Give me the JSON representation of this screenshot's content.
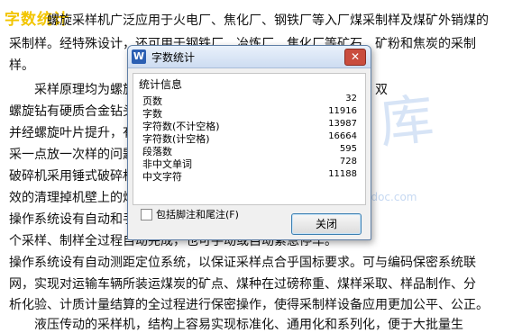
{
  "document": {
    "title": "字数统计",
    "lines": [
      "螺旋采样机广泛应用于火电厂、焦化厂、钢铁厂等入厂煤采制样及煤矿外销煤的",
      "采制样。经特殊设计，还可用于钢铁厂、冶炼厂、焦化厂等矿石、矿粉和焦炭的采制",
      "样。",
      "　　采样原理均为螺旋钻取方式，全断面采样，能避免样品污染。双",
      "螺旋钻有硬质合金钻头，对于大块煤或煤矸石钻碎，",
      "并经螺旋叶片提升，有效地解决了点采样须",
      "采一点放一次样的问题，实现采三点放一次样的目的。",
      "破碎机采用锤式破碎机，平移刮板，能及时和有",
      "效的清理掉机壁上的煤。出料粒度小于 6mm/13mm 的样料。",
      "操作系统设有自动和手动两种模式，只需按下启动命令，整",
      "个采样、制样全过程自动完成，也可手动或自动紧急停车。",
      "操作系统设有自动测距定位系统，以保证采样点合乎国标要求。可与编码保密系统联",
      "网，实现对运输车辆所装运煤炭的矿点、煤种在过磅称重、煤样采取、样品制作、分",
      "析化验、计质计量结算的全过程进行保密操作，使得采制样设备应用更加公平、公正。",
      "　　液压传动的采样机，结构上容易实现标准化、通用化和系列化，便于大批量生"
    ]
  },
  "watermark": {
    "text": "人人文库",
    "sub": "www.renrendoc.com"
  },
  "dialog": {
    "app_icon": "W",
    "title": "字数统计",
    "close_icon": "close-icon",
    "group_title": "统计信息",
    "stats": [
      {
        "label": "页数",
        "value": "32"
      },
      {
        "label": "字数",
        "value": "11916"
      },
      {
        "label": "字符数(不计空格)",
        "value": "13987"
      },
      {
        "label": "字符数(计空格)",
        "value": "16664"
      },
      {
        "label": "段落数",
        "value": "595"
      },
      {
        "label": "非中文单词",
        "value": "728"
      },
      {
        "label": "中文字符",
        "value": "11188"
      }
    ],
    "checkbox_label": "包括脚注和尾注(F)",
    "checkbox_checked": false,
    "ok_label": "关闭"
  }
}
